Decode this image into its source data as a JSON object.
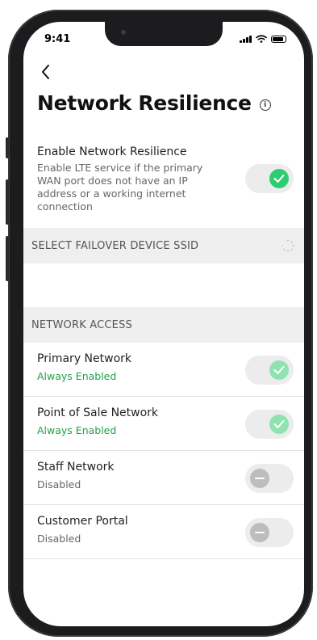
{
  "status_bar": {
    "time": "9:41"
  },
  "page": {
    "title": "Network Resilience",
    "info_icon": "info-icon"
  },
  "resilience": {
    "label": "Enable Network Resilience",
    "description": "Enable LTE service if the primary WAN port does not have an IP address or a working internet connection",
    "enabled": true
  },
  "failover": {
    "header": "SELECT FAILOVER DEVICE SSID"
  },
  "network_access": {
    "header": "NETWORK ACCESS",
    "items": [
      {
        "name": "Primary Network",
        "status": "Always Enabled",
        "enabled": true
      },
      {
        "name": "Point of Sale Network",
        "status": "Always Enabled",
        "enabled": true
      },
      {
        "name": "Staff Network",
        "status": "Disabled",
        "enabled": false
      },
      {
        "name": "Customer Portal",
        "status": "Disabled",
        "enabled": false
      }
    ]
  },
  "colors": {
    "toggle_on": "#2ecc71",
    "toggle_on_faded": "#8ee3b0",
    "enabled_text": "#22a04b",
    "section_bg": "#efefef"
  }
}
